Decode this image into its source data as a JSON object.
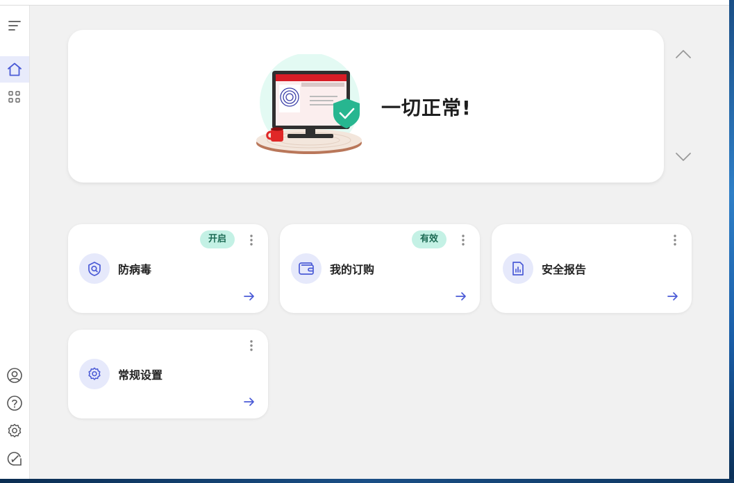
{
  "hero": {
    "status_text": "一切正常!"
  },
  "cards": [
    {
      "title": "防病毒",
      "badge": "开启",
      "icon": "shield-search-icon"
    },
    {
      "title": "我的订购",
      "badge": "有效",
      "icon": "wallet-icon"
    },
    {
      "title": "安全报告",
      "badge": "",
      "icon": "report-chart-icon"
    },
    {
      "title": "常规设置",
      "badge": "",
      "icon": "gear-icon"
    }
  ],
  "colors": {
    "accent": "#4a5ad6",
    "badge_bg": "#c4f1e5",
    "badge_text": "#1d6b55",
    "active_nav_bg": "#e8ebfb"
  }
}
